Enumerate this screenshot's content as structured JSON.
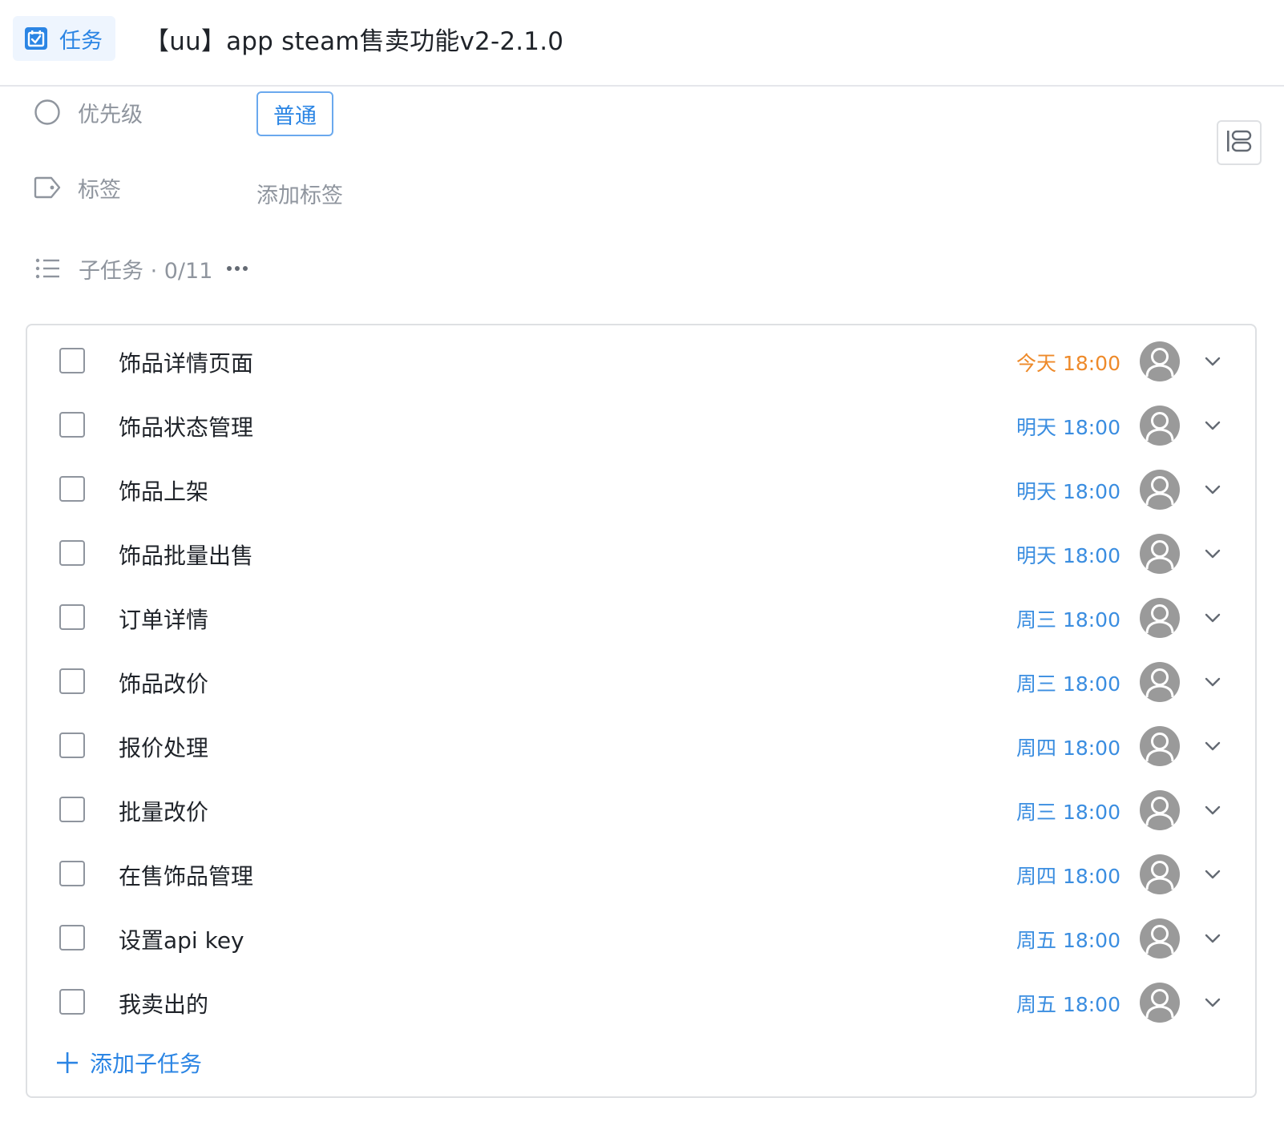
{
  "header": {
    "type_label": "任务",
    "title": "【uu】app steam售卖功能v2-2.1.0"
  },
  "fields": {
    "priority_label": "优先级",
    "priority_value": "普通",
    "tags_label": "标签",
    "add_tag": "添加标签"
  },
  "subtasks": {
    "label": "子任务 · 0/11",
    "add_label": "添加子任务",
    "items": [
      {
        "title": "饰品详情页面",
        "due": "今天 18:00",
        "due_color": "#ee8a2a"
      },
      {
        "title": "饰品状态管理",
        "due": "明天 18:00",
        "due_color": "#3a8de0"
      },
      {
        "title": "饰品上架",
        "due": "明天 18:00",
        "due_color": "#3a8de0"
      },
      {
        "title": "饰品批量出售",
        "due": "明天 18:00",
        "due_color": "#3a8de0"
      },
      {
        "title": "订单详情",
        "due": "周三 18:00",
        "due_color": "#3a8de0"
      },
      {
        "title": "饰品改价",
        "due": "周三 18:00",
        "due_color": "#3a8de0"
      },
      {
        "title": "报价处理",
        "due": "周四 18:00",
        "due_color": "#3a8de0"
      },
      {
        "title": "批量改价",
        "due": "周三 18:00",
        "due_color": "#3a8de0"
      },
      {
        "title": "在售饰品管理",
        "due": "周四 18:00",
        "due_color": "#3a8de0"
      },
      {
        "title": "设置api key",
        "due": "周五 18:00",
        "due_color": "#3a8de0"
      },
      {
        "title": "我卖出的",
        "due": "周五 18:00",
        "due_color": "#3a8de0"
      }
    ]
  },
  "colors": {
    "accent": "#2b85e4",
    "today": "#ee8a2a",
    "upcoming": "#3a8de0"
  }
}
